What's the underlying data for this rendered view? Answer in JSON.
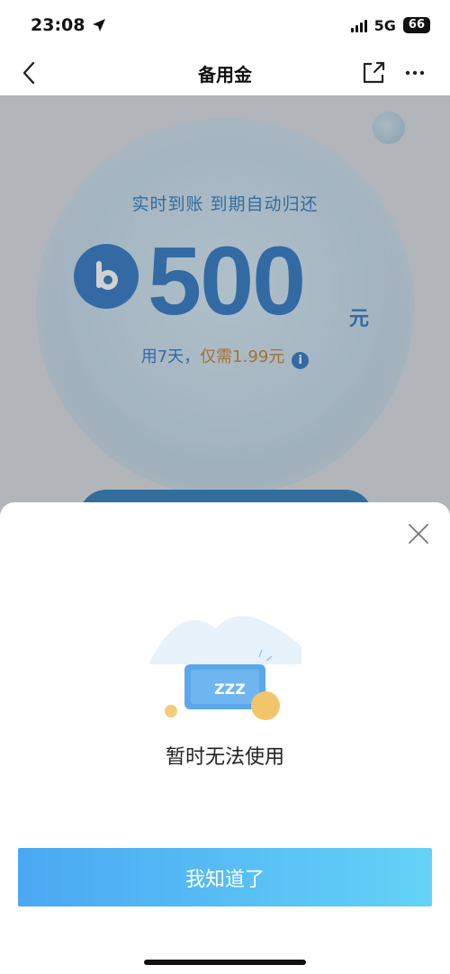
{
  "status_bar": {
    "time": "23:08",
    "network": "5G",
    "battery": "66"
  },
  "nav": {
    "title": "备用金"
  },
  "hero": {
    "subtitle": "实时到账 到期自动归还",
    "amount": "500",
    "unit": "元",
    "fee_prefix": "用7天，",
    "fee_highlight": "仅需1.99元",
    "logo_letter": "b"
  },
  "sheet": {
    "message": "暂时无法使用",
    "confirm_label": "我知道了",
    "illustration_text": "ZZZ"
  },
  "colors": {
    "brand_blue": "#3f82c8",
    "fee_orange": "#c98a3d",
    "button_start": "#4aa8f2",
    "button_end": "#64d2f7"
  }
}
